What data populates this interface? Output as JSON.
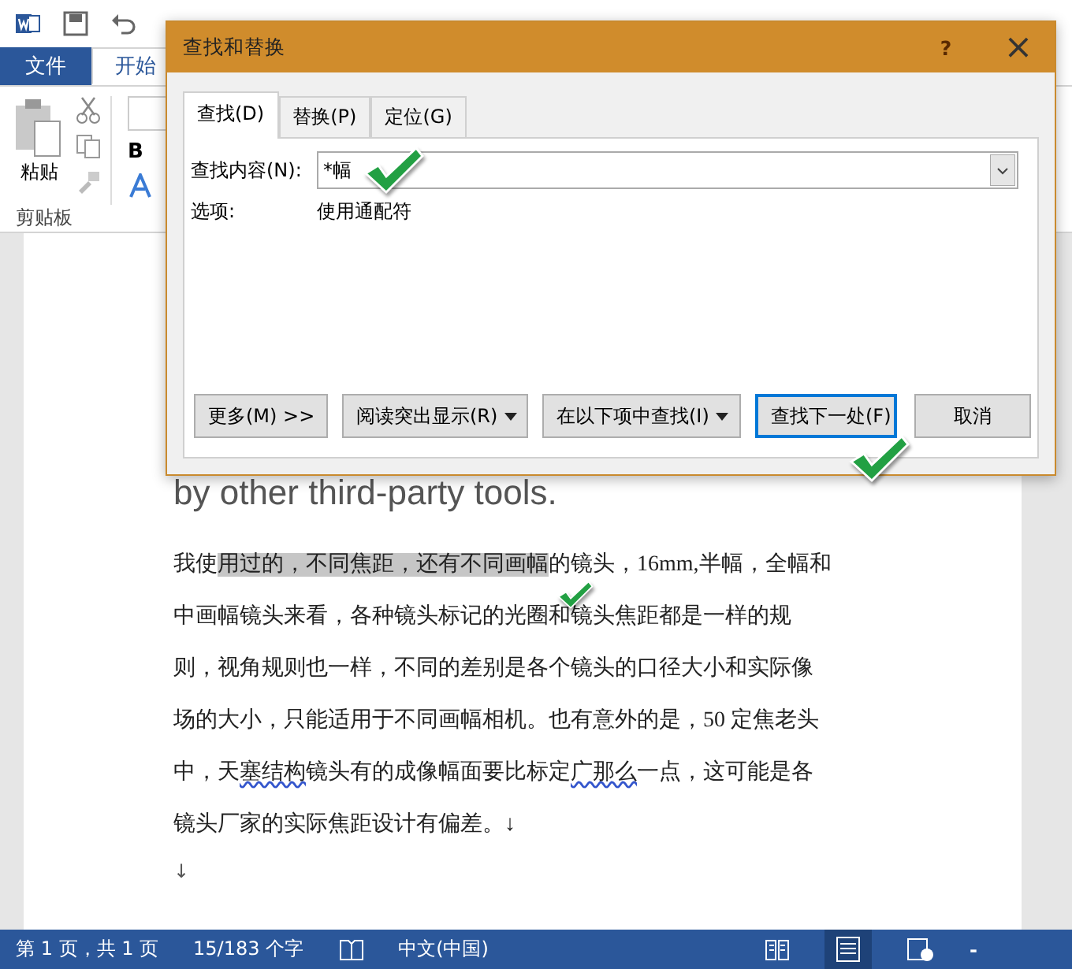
{
  "ribbon_tabs": [
    {
      "label": "文件",
      "kind": "file",
      "selected": false
    },
    {
      "label": "开始",
      "kind": "tab",
      "selected": true
    }
  ],
  "ribbon": {
    "paste_label": "粘贴",
    "group_label": "剪贴板",
    "bold_label": "B"
  },
  "dialog": {
    "title": "查找和替换",
    "help": "?",
    "close": "×",
    "tabs": [
      {
        "label": "查找(D)",
        "selected": true
      },
      {
        "label": "替换(P)",
        "selected": false
      },
      {
        "label": "定位(G)",
        "selected": false
      }
    ],
    "find_label": "查找内容(N):",
    "find_value": "*幅",
    "options_label": "选项:",
    "options_value": "使用通配符",
    "buttons": [
      {
        "label": "更多(M) >>",
        "dropdown": false,
        "default": false
      },
      {
        "label": "阅读突出显示(R)",
        "dropdown": true,
        "default": false
      },
      {
        "label": "在以下项中查找(I)",
        "dropdown": true,
        "default": false
      },
      {
        "label": "查找下一处(F)",
        "dropdown": false,
        "default": true
      },
      {
        "label": "取消",
        "dropdown": false,
        "default": false
      }
    ]
  },
  "document": {
    "heading": "by other third-party tools.",
    "paragraph": [
      {
        "text": "我使",
        "kind": "plain"
      },
      {
        "text": "用过的，不同焦距，还有不同画幅",
        "kind": "highlight"
      },
      {
        "text": "的镜头，16mm,半幅，全幅和中画幅镜头来看，各种镜头标记的光圈和镜头焦距都是一样的规则，视角规则也一样，不同的差别是各个镜头的口径大小和实际像场的大小，只能适用于不同画幅相机。也有意外的是，50 定焦老头中，天",
        "kind": "plain"
      },
      {
        "text": "塞结构",
        "kind": "misspelled"
      },
      {
        "text": "镜头有的成像幅面要比标定",
        "kind": "plain"
      },
      {
        "text": "广那么",
        "kind": "misspelled"
      },
      {
        "text": "一点，这可能是各镜头厂家的实际焦距设计有偏差。↓",
        "kind": "plain"
      }
    ],
    "empty_mark": "↓"
  },
  "status_bar": {
    "page": "第 1 页，共 1 页",
    "words": "15/183 个字",
    "language": "中文(中国)",
    "zoom_out": "-"
  }
}
